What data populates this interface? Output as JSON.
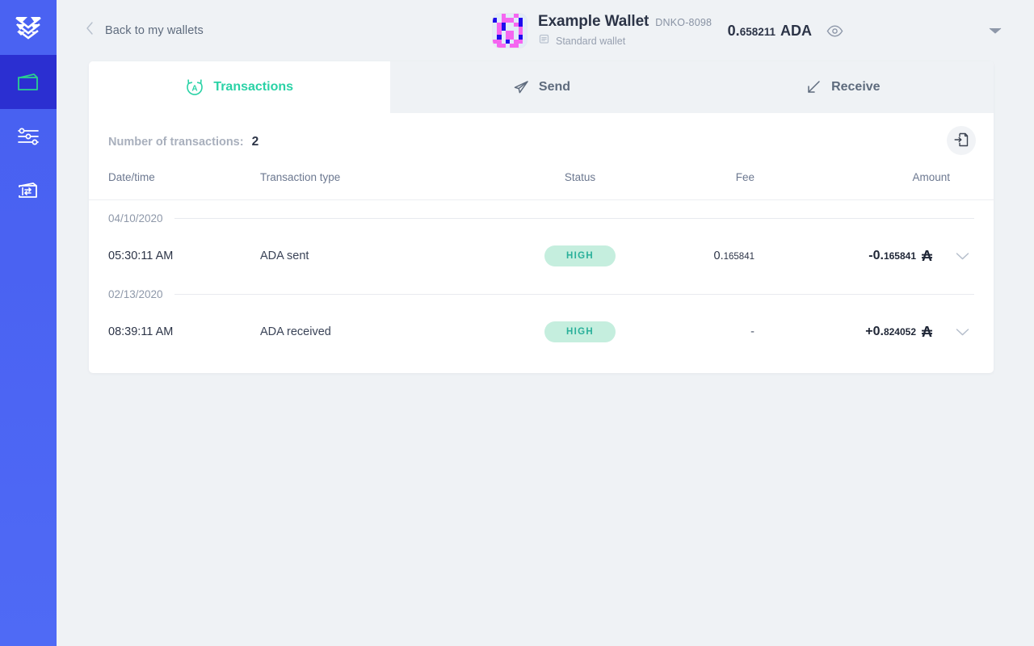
{
  "colors": {
    "sidebar_bg": "#4a62f2",
    "sidebar_active_bg": "#2b2fd1",
    "accent_teal": "#2ad2a6",
    "badge_bg": "#c5eede",
    "badge_text": "#2ab09a",
    "page_bg": "#eff2f5",
    "card_bg": "#ffffff",
    "text_dark": "#2c3447",
    "text_muted": "#8e98a9"
  },
  "sidebar": {
    "logo_name": "daedalus-logo-icon",
    "items": [
      {
        "name": "sidebar-item-wallets",
        "icon": "wallet-icon",
        "active": true
      },
      {
        "name": "sidebar-item-settings",
        "icon": "sliders-icon",
        "active": false
      },
      {
        "name": "sidebar-item-transfer",
        "icon": "wallet-exchange-icon",
        "active": false
      }
    ]
  },
  "header": {
    "back_label": "Back to my wallets",
    "back_icon": "chevron-left-icon",
    "wallet_name": "Example Wallet",
    "wallet_id": "DNKO-8098",
    "wallet_kind": "Standard wallet",
    "wallet_kind_icon": "wallet-type-icon",
    "avatar_name": "wallet-identicon",
    "balance_integer": "0.",
    "balance_decimal": "658211",
    "balance_unit": "ADA",
    "eye_icon": "eye-icon",
    "caret_icon": "chevron-down-icon"
  },
  "identicon_grid": [
    [
      "l",
      "l",
      "m",
      "l",
      "l",
      "m",
      "l",
      "l"
    ],
    [
      "b",
      "l",
      "m",
      "m",
      "m",
      "l",
      "b",
      "l"
    ],
    [
      "l",
      "m",
      "b",
      "l",
      "l",
      "m",
      "b",
      "l"
    ],
    [
      "l",
      "m",
      "b",
      "l",
      "l",
      "l",
      "m",
      "l"
    ],
    [
      "l",
      "m",
      "l",
      "m",
      "m",
      "l",
      "m",
      "l"
    ],
    [
      "l",
      "b",
      "l",
      "m",
      "m",
      "l",
      "b",
      "l"
    ],
    [
      "m",
      "m",
      "l",
      "b",
      "l",
      "m",
      "m",
      "l"
    ],
    [
      "l",
      "m",
      "m",
      "l",
      "m",
      "m",
      "l",
      "l"
    ]
  ],
  "identicon_palette": {
    "l": "#e2ecf8",
    "m": "#f566f0",
    "b": "#1f0ced"
  },
  "tabs": [
    {
      "label": "Transactions",
      "icon": "transactions-circle-icon",
      "active": true,
      "name": "tab-transactions"
    },
    {
      "label": "Send",
      "icon": "paper-plane-icon",
      "active": false,
      "name": "tab-send"
    },
    {
      "label": "Receive",
      "icon": "arrow-down-left-icon",
      "active": false,
      "name": "tab-receive"
    }
  ],
  "transactions_panel": {
    "count_label": "Number of transactions:",
    "count_value": "2",
    "export_icon": "export-csv-icon",
    "columns": {
      "date": "Date/time",
      "type": "Transaction type",
      "status": "Status",
      "fee": "Fee",
      "amount": "Amount"
    },
    "groups": [
      {
        "date": "04/10/2020",
        "rows": [
          {
            "time": "05:30:11 AM",
            "type": "ADA sent",
            "status": "HIGH",
            "fee_int": "0.",
            "fee_dec": "165841",
            "fee_dash": "",
            "amount_int": "-0.",
            "amount_dec": "165841",
            "currency_symbol": "₳",
            "chevron": "chevron-down-icon"
          }
        ]
      },
      {
        "date": "02/13/2020",
        "rows": [
          {
            "time": "08:39:11 AM",
            "type": "ADA received",
            "status": "HIGH",
            "fee_int": "",
            "fee_dec": "",
            "fee_dash": "-",
            "amount_int": "+0.",
            "amount_dec": "824052",
            "currency_symbol": "₳",
            "chevron": "chevron-down-icon"
          }
        ]
      }
    ]
  }
}
